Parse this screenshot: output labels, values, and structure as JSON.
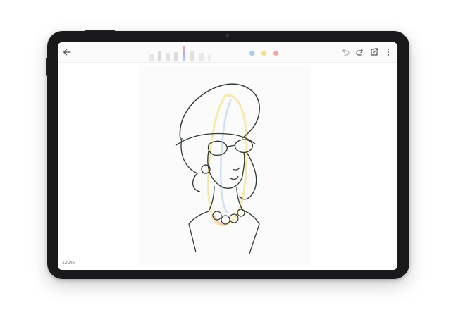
{
  "toolbar": {
    "icons": [
      "back-arrow-icon",
      "undo-icon",
      "redo-icon",
      "export-icon",
      "more-vert-icon"
    ],
    "pens": [
      "pencil-icon",
      "ballpoint-pen-icon",
      "fountain-pen-icon",
      "brush-icon",
      "marker-icon",
      "eraser-icon",
      "lasso-icon"
    ],
    "colors": [
      "#a9c8f2",
      "#f5dd86",
      "#f2a7a1"
    ]
  },
  "status": {
    "zoom": "120%"
  }
}
